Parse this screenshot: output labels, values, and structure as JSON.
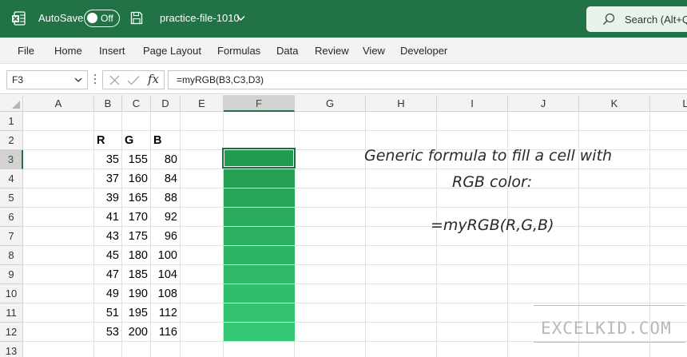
{
  "titlebar": {
    "autosave_label": "AutoSave",
    "autosave_state": "Off",
    "filename": "practice-file-1010",
    "search_placeholder": "Search (Alt+Q)",
    "bg_color": "#217346"
  },
  "ribbon": {
    "tabs": [
      "File",
      "Home",
      "Insert",
      "Page Layout",
      "Formulas",
      "Data",
      "Review",
      "View",
      "Developer"
    ]
  },
  "formula_bar": {
    "name_box": "F3",
    "fx_label": "fx",
    "formula": "=myRGB(B3,C3,D3)"
  },
  "sheet": {
    "columns": [
      "A",
      "B",
      "C",
      "D",
      "E",
      "F",
      "G",
      "H",
      "I",
      "J",
      "K",
      "L"
    ],
    "rows": [
      "1",
      "2",
      "3",
      "4",
      "5",
      "6",
      "7",
      "8",
      "9",
      "10",
      "11",
      "12",
      "13"
    ],
    "selected_column": "F",
    "selected_row": "3",
    "headers": [
      "R",
      "G",
      "B"
    ],
    "data": [
      {
        "r": 35,
        "g": 155,
        "b": 80
      },
      {
        "r": 37,
        "g": 160,
        "b": 84
      },
      {
        "r": 39,
        "g": 165,
        "b": 88
      },
      {
        "r": 41,
        "g": 170,
        "b": 92
      },
      {
        "r": 43,
        "g": 175,
        "b": 96
      },
      {
        "r": 45,
        "g": 180,
        "b": 100
      },
      {
        "r": 47,
        "g": 185,
        "b": 104
      },
      {
        "r": 49,
        "g": 190,
        "b": 108
      },
      {
        "r": 51,
        "g": 195,
        "b": 112
      },
      {
        "r": 53,
        "g": 200,
        "b": 116
      }
    ]
  },
  "note": {
    "line1": "Generic formula to fill a cell with",
    "line2": "RGB color:",
    "formula": "=myRGB(R,G,B)"
  },
  "watermark": "EXCELKID.COM"
}
